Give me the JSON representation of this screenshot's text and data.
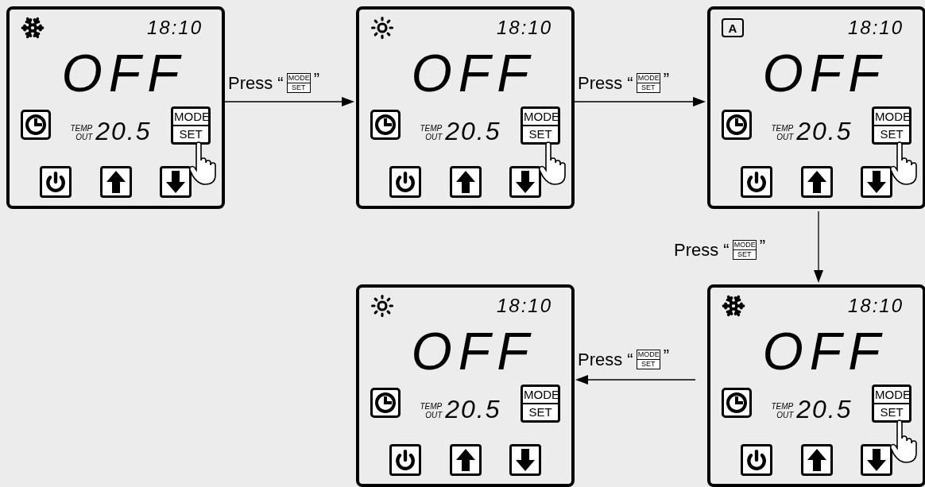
{
  "panels": [
    {
      "kind": "cool",
      "time": "18:10",
      "status": "OFF",
      "temp_label_top": "TEMP",
      "temp_label_bottom": "OUT",
      "temp": "20.5",
      "key_top": "MODE",
      "key_bottom": "SET",
      "pressed": true
    },
    {
      "kind": "heat",
      "time": "18:10",
      "status": "OFF",
      "temp_label_top": "TEMP",
      "temp_label_bottom": "OUT",
      "temp": "20.5",
      "key_top": "MODE",
      "key_bottom": "SET",
      "pressed": true
    },
    {
      "kind": "auto",
      "mode_letter": "A",
      "time": "18:10",
      "status": "OFF",
      "temp_label_top": "TEMP",
      "temp_label_bottom": "OUT",
      "temp": "20.5",
      "key_top": "MODE",
      "key_bottom": "SET",
      "pressed": true
    },
    {
      "kind": "heat",
      "time": "18:10",
      "status": "OFF",
      "temp_label_top": "TEMP",
      "temp_label_bottom": "OUT",
      "temp": "20.5",
      "key_top": "MODE",
      "key_bottom": "SET",
      "pressed": false
    },
    {
      "kind": "cool",
      "time": "18:10",
      "status": "OFF",
      "temp_label_top": "TEMP",
      "temp_label_bottom": "OUT",
      "temp": "20.5",
      "key_top": "MODE",
      "key_bottom": "SET",
      "pressed": true
    }
  ],
  "arrows": [
    {
      "kind": "right",
      "label": "Press “",
      "key_top": "MODE",
      "key_bottom": "SET",
      "close": "”"
    },
    {
      "kind": "right",
      "label": "Press “",
      "key_top": "MODE",
      "key_bottom": "SET",
      "close": "”"
    },
    {
      "kind": "down",
      "label": "Press “",
      "key_top": "MODE",
      "key_bottom": "SET",
      "close": "”"
    },
    {
      "kind": "left",
      "label": "Press “",
      "key_top": "MODE",
      "key_bottom": "SET",
      "close": "”"
    }
  ]
}
